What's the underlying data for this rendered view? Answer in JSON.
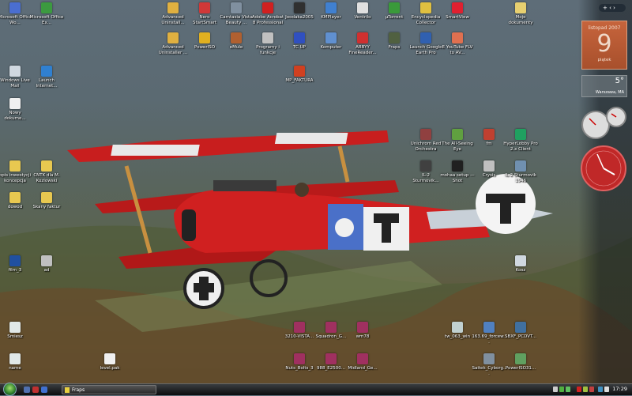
{
  "desktop": {
    "icons": [
      {
        "label": "Microsoft Office Wo...",
        "color": "#4a6ed0"
      },
      {
        "label": "Microsoft Office Ex...",
        "color": "#3c9a40"
      },
      {
        "label": "Advanced Uninstall...",
        "color": "#e0b040"
      },
      {
        "label": "Nero StartSmart",
        "color": "#d03838"
      },
      {
        "label": "Camtasia Vista Beauty ...",
        "color": "#8090a0"
      },
      {
        "label": "Adobe Acrobat 8 Professional",
        "color": "#d02020"
      },
      {
        "label": "Joodaka2005",
        "color": "#303030"
      },
      {
        "label": "KMPlayer",
        "color": "#4080d0"
      },
      {
        "label": "Ventrilo",
        "color": "#e0e0e0"
      },
      {
        "label": "µTorrent",
        "color": "#3a9a3a"
      },
      {
        "label": "Encyclopedia Collector",
        "color": "#e0c040"
      },
      {
        "label": "SmartView",
        "color": "#e02030"
      },
      {
        "label": "Moje dokumenty",
        "color": "#e8d070"
      },
      {
        "label": "Advanced Uninstaller ...",
        "color": "#e0b040"
      },
      {
        "label": "PowerISO",
        "color": "#e0b020"
      },
      {
        "label": "eMule",
        "color": "#b06030"
      },
      {
        "label": "Programy i funkcje",
        "color": "#c0c0c0"
      },
      {
        "label": "TC UP",
        "color": "#3050c0"
      },
      {
        "label": "Komputer",
        "color": "#6090d0"
      },
      {
        "label": "ABBYY FineReader...",
        "color": "#d03030"
      },
      {
        "label": "Fraps",
        "color": "#506040"
      },
      {
        "label": "Launch Google Earth Pro",
        "color": "#3060b0"
      },
      {
        "label": "E YouTube FLV to AV...",
        "color": "#e07050"
      },
      {
        "label": "Windows Live Mail",
        "color": "#d0d8e0"
      },
      {
        "label": "Launch Internet...",
        "color": "#3080d0"
      },
      {
        "label": "MP_FAKTURA",
        "color": "#d04020"
      },
      {
        "label": "Nowy dokume...",
        "color": "#f0f0f0"
      },
      {
        "label": "Unichrom Red Orchestra",
        "color": "#904040"
      },
      {
        "label": "The All-Seeing Eye",
        "color": "#60a040"
      },
      {
        "label": "fm",
        "color": "#c04030"
      },
      {
        "label": "HyperLobby Pro 2.x Client",
        "color": "#20a060"
      },
      {
        "label": "IL-2 Sturmovik...",
        "color": "#404040"
      },
      {
        "label": "mohaa setup — Shot",
        "color": "#202020"
      },
      {
        "label": "Crysis",
        "color": "#c0c0c0"
      },
      {
        "label": "IL-2 Sturmovik 1946",
        "color": "#7090b0"
      },
      {
        "label": "opis inwestycji koncepcja",
        "color": "#e8c850"
      },
      {
        "label": "CNTK dla M. Kozlowski",
        "color": "#e8c850"
      },
      {
        "label": "dowod",
        "color": "#e8c850"
      },
      {
        "label": "Skany faktur",
        "color": "#e8c850"
      },
      {
        "label": "film_3",
        "color": "#2050a0"
      },
      {
        "label": "ad",
        "color": "#c0c0c0"
      },
      {
        "label": "Kosz",
        "color": "#d0d8e0"
      },
      {
        "label": "Smiesz",
        "color": "#e0e8e8"
      },
      {
        "label": "name",
        "color": "#e0e8e8"
      },
      {
        "label": "level.pak",
        "color": "#f0f0f0"
      },
      {
        "label": "3210-VISTA...",
        "color": "#a03060"
      },
      {
        "label": "Squadron_G...",
        "color": "#a03060"
      },
      {
        "label": "wm78",
        "color": "#a03060"
      },
      {
        "label": "tw_063_win",
        "color": "#c0d0d0"
      },
      {
        "label": "163.69_forcew...",
        "color": "#5080c0"
      },
      {
        "label": "SBXF_PCDVT...",
        "color": "#4070a0"
      },
      {
        "label": "Nuts_Bolts_3",
        "color": "#a03060"
      },
      {
        "label": "988_E2500...",
        "color": "#a03060"
      },
      {
        "label": "Midland_Ge...",
        "color": "#a03060"
      },
      {
        "label": "Saitek_Cyborg...",
        "color": "#8090a0"
      },
      {
        "label": "PowerISO31...",
        "color": "#60a060"
      }
    ]
  },
  "sidebar": {
    "controls": "+  ‹ ›",
    "calendar": {
      "month": "listopad 2007",
      "day": "9",
      "weekday": "piątek"
    },
    "weather": {
      "temp": "5°",
      "city": "Warszawa, MA"
    }
  },
  "taskbar": {
    "tasks": [
      {
        "label": "Fraps"
      }
    ],
    "clock": "17:29"
  }
}
